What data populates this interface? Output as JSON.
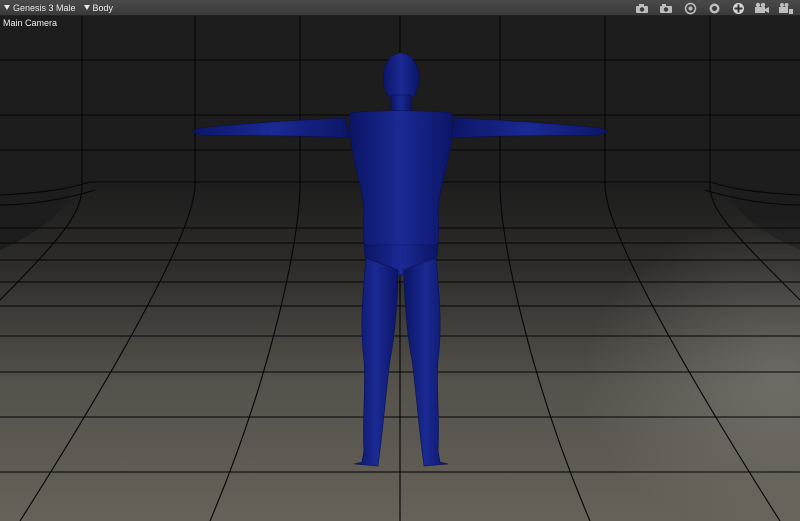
{
  "toolbar": {
    "scene_node": "Genesis 3 Male",
    "node_part": "Body",
    "tools": [
      "camera-icon",
      "camera-alt-icon",
      "orbit-icon",
      "record-icon",
      "add-icon",
      "video-camera-icon",
      "view-layout-icon"
    ]
  },
  "viewport": {
    "camera_label": "Main Camera"
  },
  "colors": {
    "figure": "#1a2a8a",
    "floor": "#5e5b54",
    "wall": "#1d1d1d",
    "grid": "#050505"
  }
}
